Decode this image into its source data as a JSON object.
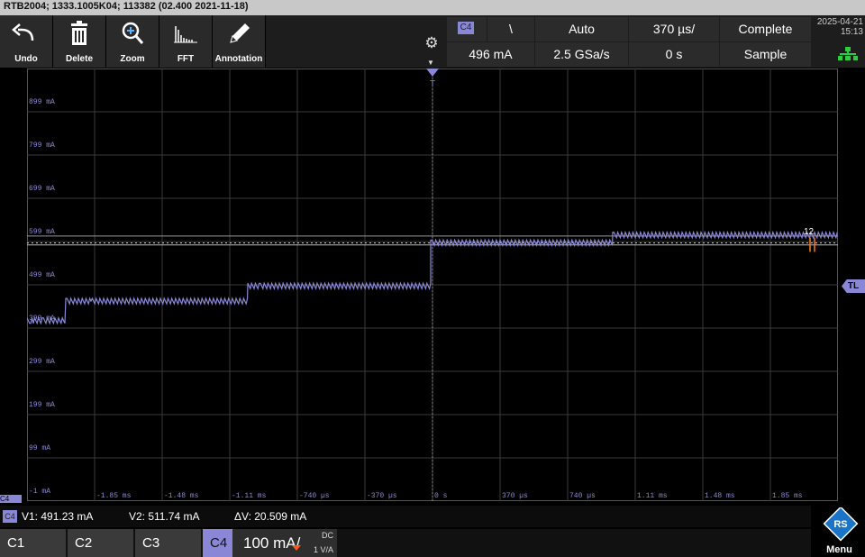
{
  "title_bar": {
    "text": "RTB2004; 1333.1005K04; 113382 (02.400 2021-11-18)"
  },
  "toolbar": {
    "buttons": [
      {
        "label": "Undo",
        "icon": "undo-arrow-icon"
      },
      {
        "label": "Delete",
        "icon": "trash-icon"
      },
      {
        "label": "Zoom",
        "icon": "zoom-plus-icon"
      },
      {
        "label": "FFT",
        "icon": "fft-spectrum-icon"
      },
      {
        "label": "Annotation",
        "icon": "pencil-icon"
      }
    ],
    "settings_icon": "gear-icon"
  },
  "info": {
    "trigger_source": "C4",
    "trigger_slope": "\\",
    "trigger_mode": "Auto",
    "timebase": "370 µs/",
    "acq_state": "Complete",
    "trigger_level": "496 mA",
    "sample_rate": "2.5 GSa/s",
    "horiz_position": "0 s",
    "acq_mode": "Sample"
  },
  "datetime": {
    "date": "2025-04-21",
    "time": "15:13"
  },
  "network_icon": "network-connected-icon",
  "grid": {
    "y_labels": [
      "899 mA",
      "799 mA",
      "699 mA",
      "599 mA",
      "499 mA",
      "399 mA",
      "299 mA",
      "199 mA",
      "99 mA",
      "-1 mA"
    ],
    "x_labels": [
      "-1.85 ms",
      "-1.48 ms",
      "-1.11 ms",
      "-740 µs",
      "-370 µs",
      "0 s",
      "370 µs",
      "740 µs",
      "1.11 ms",
      "1.48 ms",
      "1.85 ms"
    ],
    "trigger_marker": "T",
    "trigger_level_marker": "TL",
    "cursor_labels": "12"
  },
  "channel_marker": "C4",
  "measurements": {
    "channel": "C4",
    "v1": "V1: 491.23 mA",
    "v2": "V2: 511.74 mA",
    "dv": "ΔV: 20.509 mA"
  },
  "channels": {
    "c1": "C1",
    "c2": "C2",
    "c3": "C3",
    "c4": "C4",
    "c4_scale": "100 mA/",
    "c4_coupling": "DC",
    "c4_probe": "1 V/A"
  },
  "menu": {
    "label": "Menu",
    "icon": "rs-logo-icon"
  },
  "colors": {
    "ch4": "#8a88d6",
    "cursor": "#ff7a1a",
    "grid": "#3a3a3a"
  }
}
